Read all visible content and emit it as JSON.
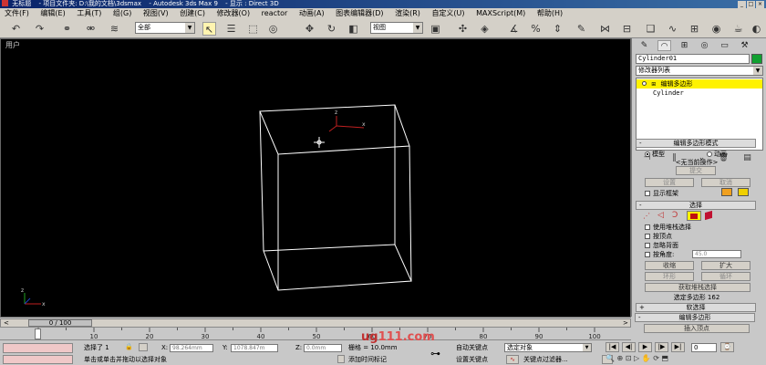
{
  "titlebar": {
    "doc": "无标题",
    "project": "- 项目文件夹: D:\\我的文档\\3dsmax",
    "app": "- Autodesk 3ds Max 9",
    "display": "- 显示 : Direct 3D"
  },
  "menu": [
    "文件(F)",
    "编辑(E)",
    "工具(T)",
    "组(G)",
    "视图(V)",
    "创建(C)",
    "修改器(O)",
    "reactor",
    "动画(A)",
    "图表编辑器(D)",
    "渲染(R)",
    "自定义(U)",
    "MAXScript(M)",
    "帮助(H)"
  ],
  "toolbar": {
    "selection_filter": "全部",
    "ref_coord": "视图",
    "icons": [
      "undo-icon",
      "redo-icon",
      "link-icon",
      "unlink-icon",
      "bind-icon",
      "select-icon",
      "select-by-name-icon",
      "rect-region-icon",
      "window-crossing-icon",
      "move-icon",
      "rotate-icon",
      "scale-icon",
      "pivot-icon",
      "manipulate-icon",
      "snap-icon",
      "angle-snap-icon",
      "percent-snap-icon",
      "spinner-snap-icon",
      "named-selection-icon",
      "mirror-icon",
      "align-icon",
      "layer-icon",
      "curve-editor-icon",
      "schematic-icon",
      "material-editor-icon",
      "render-scene-icon",
      "quick-render-icon"
    ]
  },
  "viewport": {
    "label": "用户"
  },
  "cmdpanel": {
    "tabs": [
      "create-tab-icon",
      "modify-tab-icon",
      "hierarchy-tab-icon",
      "motion-tab-icon",
      "display-tab-icon",
      "utilities-tab-icon"
    ],
    "object_name": "Cylinder01",
    "object_color": "#10a030",
    "modifier_list": "修改器列表",
    "stack": {
      "top": "编辑多边形",
      "base": "Cylinder"
    },
    "rollout_mode": {
      "title": "编辑多边形模式",
      "radio_model": "模型",
      "radio_anim": "动画",
      "current_op": "<无当前操作>",
      "commit": "提交",
      "settings": "设置",
      "cancel": "取消",
      "show_cage": "显示框架",
      "cage_color1": "#f0a020",
      "cage_color2": "#f0d000"
    },
    "rollout_select": {
      "title": "选择",
      "use_stack": "使用堆栈选择",
      "by_vertex": "按顶点",
      "ignore_back": "忽略背面",
      "by_angle": "按角度:",
      "angle_value": "45.0",
      "shrink": "收缩",
      "grow": "扩大",
      "ring": "环形",
      "loop": "循环",
      "get_stack": "获取堆栈选择",
      "selected": "选定多边形 162"
    },
    "rollout_soft": "软选择",
    "rollout_edit": "编辑多边形",
    "insert_vertex": "插入顶点"
  },
  "timeline": {
    "slider": "0 / 100",
    "ticks": [
      "0",
      "10",
      "20",
      "30",
      "40",
      "50",
      "60",
      "70",
      "80",
      "90",
      "100"
    ]
  },
  "status": {
    "selected": "选择了 1",
    "x_label": "X:",
    "x_val": "98.264mm",
    "y_label": "Y:",
    "y_val": "1078.847m",
    "z_label": "Z:",
    "z_val": "0.0mm",
    "grid": "栅格 = 10.0mm",
    "prompt": "单击或单击并拖动以选择对象",
    "add_tag": "添加时间标记",
    "auto_key": "自动关键点",
    "set_key": "设置关键点",
    "key_filter": "关键点过滤器...",
    "sel_obj": "选定对象",
    "frame": "0",
    "watermark_a": "ug",
    "watermark_b": "111.com"
  }
}
